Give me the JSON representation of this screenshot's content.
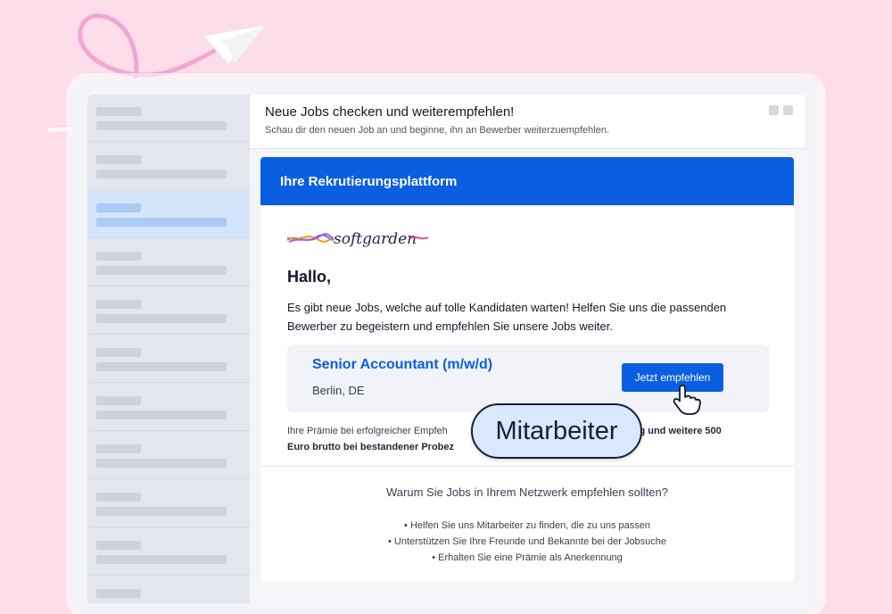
{
  "header": {
    "title": "Neue Jobs checken und weiterempfehlen!",
    "subtitle": "Schau dir den neuen Job an und beginne, ihn an Bewerber weiterzuempfehlen."
  },
  "email": {
    "banner": "Ihre Rekrutierungsplattform",
    "logo_text": "softgarden",
    "greeting": "Hallo,",
    "intro": "Es gibt neue Jobs, welche auf tolle Kandidaten warten! Helfen Sie uns die passenden Bewerber zu begeistern und empfehlen Sie unsere Jobs weiter.",
    "job": {
      "title": "Senior Accountant (m/w/d)",
      "location": "Berlin, DE",
      "button": "Jetzt empfehlen"
    },
    "bonus_visible_start": "Ihre Prämie bei erfolgreicher Empfeh",
    "bonus_visible_end": "ng und weitere 500",
    "bonus_line2": "Euro brutto bei bestandener Probez",
    "why_title": "Warum Sie Jobs in Ihrem Netzwerk empfehlen sollten?",
    "reasons": [
      "Helfen Sie uns Mitarbeiter zu finden, die zu uns passen",
      "Unterstützen Sie Ihre Freunde und Bekannte bei der Jobsuche",
      "Erhalten Sie eine Prämie als Anerkennung"
    ]
  },
  "badge": "Mitarbeiter",
  "colors": {
    "background": "#fcdde9",
    "accent": "#0a5ee0",
    "badge_fill": "#d9e8fc",
    "sidebar_active": "#d4e5fb"
  },
  "icons": [
    "paper-plane-icon",
    "hand-pointer-icon",
    "softgarden-logo"
  ]
}
